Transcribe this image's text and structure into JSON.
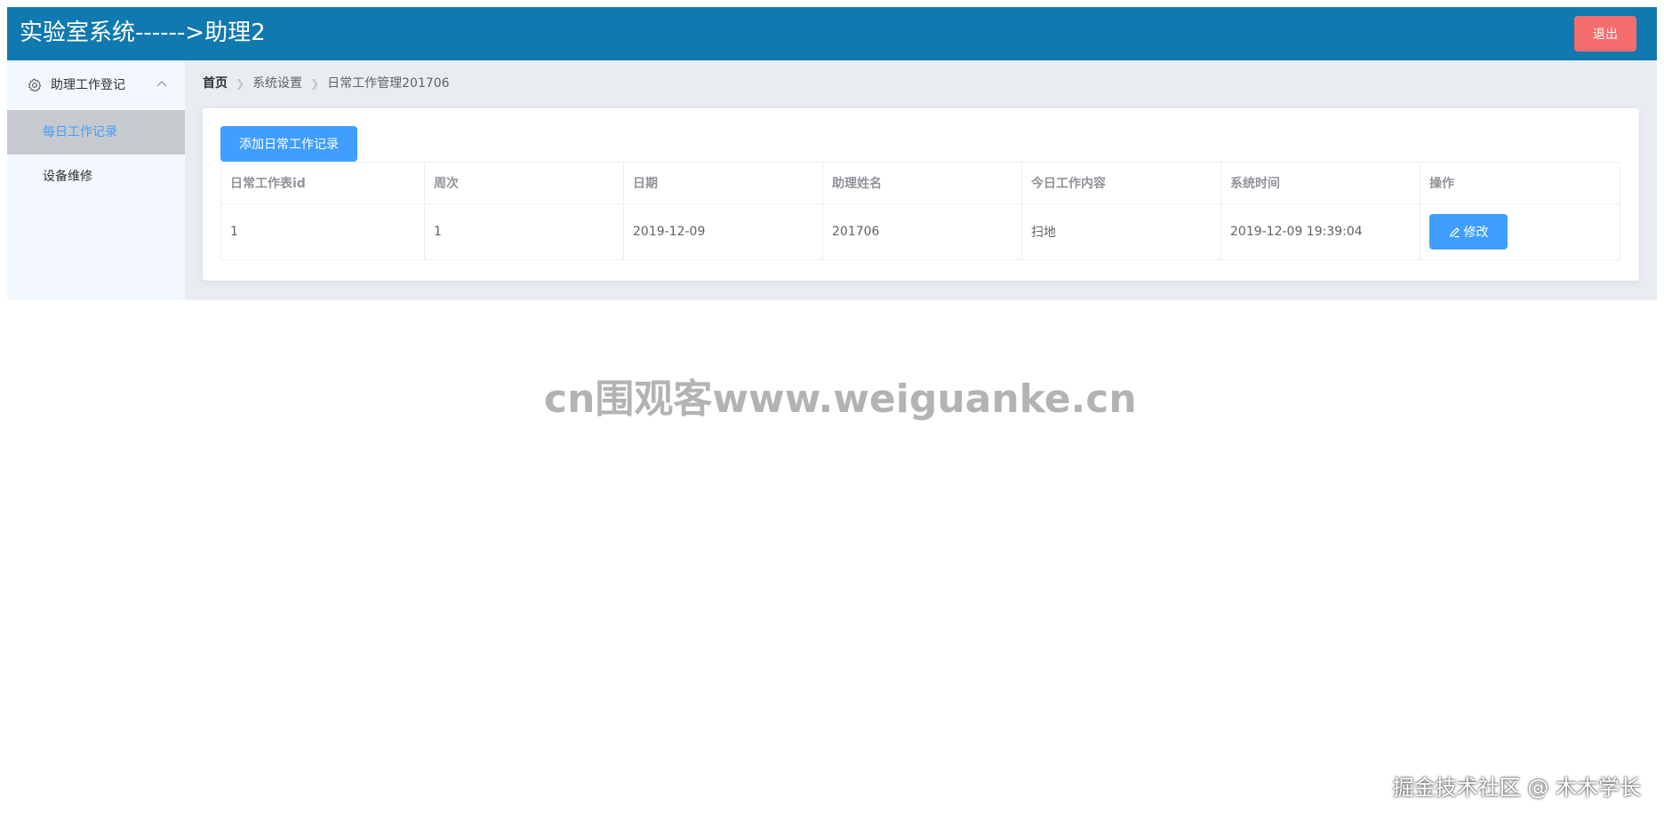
{
  "header": {
    "title": "实验室系统------>助理2",
    "logout_label": "退出"
  },
  "sidebar": {
    "group": {
      "label": "助理工作登记",
      "icon": "gear-icon",
      "expanded": true
    },
    "items": [
      {
        "label": "每日工作记录",
        "active": true
      },
      {
        "label": "设备维修",
        "active": false
      }
    ]
  },
  "breadcrumb": {
    "items": [
      "首页",
      "系统设置",
      "日常工作管理201706"
    ]
  },
  "main": {
    "add_button_label": "添加日常工作记录",
    "table": {
      "columns": [
        "日常工作表id",
        "周次",
        "日期",
        "助理姓名",
        "今日工作内容",
        "系统时间",
        "操作"
      ],
      "rows": [
        {
          "cells": [
            "1",
            "1",
            "2019-12-09",
            "201706",
            "扫地",
            "2019-12-09 19:39:04"
          ],
          "action_label": "修改"
        }
      ]
    }
  },
  "watermarks": {
    "center": "cn围观客www.weiguanke.cn",
    "corner": "掘金技术社区 @ 木木学长"
  },
  "colors": {
    "header_bg": "#1079b0",
    "logout_bg": "#f56c6c",
    "primary": "#409eff",
    "sidebar_bg": "#f2f8fe",
    "sidebar_active_bg": "#c6c9cd",
    "main_bg": "#e9edf1"
  }
}
